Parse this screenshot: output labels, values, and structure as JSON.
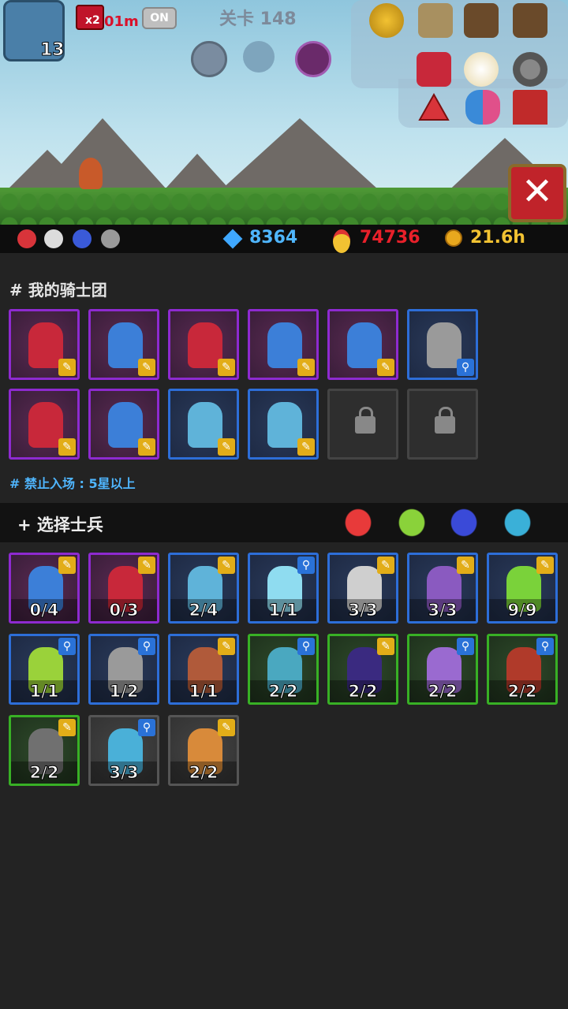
{
  "hud": {
    "player_level": "13",
    "speed_multiplier": "x2",
    "speed_time": "01m",
    "auto_toggle": "ON",
    "stage_label": "关卡 148"
  },
  "resources": {
    "gems": "8364",
    "medals": "74736",
    "gold_time": "21.6h"
  },
  "close_icon": "✕",
  "knights": {
    "title": "# 我的骑士团",
    "restriction": "# 禁止入场 : 5星以上",
    "slots": [
      {
        "rarity": "purple",
        "unit": "red-knight",
        "badge": "gold"
      },
      {
        "rarity": "purple",
        "unit": "blue-hair-warrior",
        "badge": "gold"
      },
      {
        "rarity": "purple",
        "unit": "red-knight",
        "badge": "gold"
      },
      {
        "rarity": "purple",
        "unit": "blue-hair-warrior",
        "badge": "gold"
      },
      {
        "rarity": "purple",
        "unit": "blue-hair-warrior",
        "badge": "gold"
      },
      {
        "rarity": "blue",
        "unit": "armored-soldier",
        "badge": "blue"
      },
      {
        "rarity": "purple",
        "unit": "red-knight",
        "badge": "gold"
      },
      {
        "rarity": "purple",
        "unit": "blue-hair-warrior",
        "badge": "gold"
      },
      {
        "rarity": "blue",
        "unit": "hammer-orc",
        "badge": "gold"
      },
      {
        "rarity": "blue",
        "unit": "hammer-orc",
        "badge": "gold"
      },
      {
        "rarity": "locked"
      },
      {
        "rarity": "locked"
      }
    ]
  },
  "soldiers": {
    "title": "+ 选择士兵",
    "filters": [
      "red-hero-icon",
      "green-hero-icon",
      "blue-helmet-icon",
      "blue-beast-icon"
    ],
    "slots": [
      {
        "rarity": "purple",
        "unit": "blue-hair-warrior",
        "badge": "gold",
        "count": "0/4"
      },
      {
        "rarity": "purple",
        "unit": "red-knight",
        "badge": "gold",
        "count": "0/3"
      },
      {
        "rarity": "blue",
        "unit": "hammer-orc",
        "badge": "gold",
        "count": "2/4"
      },
      {
        "rarity": "blue",
        "unit": "ice-dragon",
        "badge": "blue",
        "count": "1/1"
      },
      {
        "rarity": "blue",
        "unit": "skeleton-flail",
        "badge": "gold",
        "count": "3/3"
      },
      {
        "rarity": "blue",
        "unit": "purple-reaper",
        "badge": "gold",
        "count": "3/3"
      },
      {
        "rarity": "blue",
        "unit": "green-dragon",
        "badge": "gold",
        "count": "9/9"
      },
      {
        "rarity": "blue",
        "unit": "elf-archer",
        "badge": "blue",
        "count": "1/1"
      },
      {
        "rarity": "blue",
        "unit": "armored-soldier",
        "badge": "blue",
        "count": "1/2"
      },
      {
        "rarity": "blue",
        "unit": "gunner",
        "badge": "gold",
        "count": "1/1"
      },
      {
        "rarity": "green",
        "unit": "goblin-shaman",
        "badge": "blue",
        "count": "2/2"
      },
      {
        "rarity": "green",
        "unit": "dark-mage",
        "badge": "gold",
        "count": "2/2"
      },
      {
        "rarity": "green",
        "unit": "purple-mage",
        "badge": "blue",
        "count": "2/2"
      },
      {
        "rarity": "green",
        "unit": "red-griffin",
        "badge": "blue",
        "count": "2/2"
      },
      {
        "rarity": "green",
        "unit": "gray-knight",
        "badge": "gold",
        "count": "2/2"
      },
      {
        "rarity": "gray",
        "unit": "blue-goblin",
        "badge": "blue",
        "count": "3/3"
      },
      {
        "rarity": "gray",
        "unit": "orange-archer",
        "badge": "gold",
        "count": "2/2"
      }
    ]
  },
  "colors": {
    "purple": "#8e2ad0",
    "blue": "#2d6ed8",
    "green": "#38b025",
    "gray": "#555555",
    "red-knight": "#c8283a",
    "blue-hair-warrior": "#3c7fd8",
    "armored-soldier": "#9a9a9a",
    "hammer-orc": "#5fb3d9",
    "ice-dragon": "#8fdcf0",
    "skeleton-flail": "#cfcfcf",
    "purple-reaper": "#8a5ac0",
    "green-dragon": "#7ad23a",
    "elf-archer": "#9ad23a",
    "gunner": "#b05a3a",
    "goblin-shaman": "#4aa8c0",
    "dark-mage": "#3a2a80",
    "purple-mage": "#9a6ad0",
    "red-griffin": "#b03a2a",
    "gray-knight": "#707070",
    "blue-goblin": "#4ab0d8",
    "orange-archer": "#d88a3a"
  }
}
